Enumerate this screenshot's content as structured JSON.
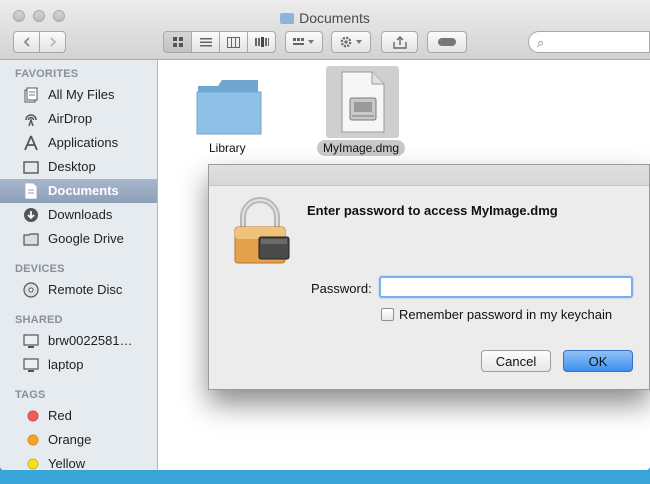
{
  "window": {
    "title": "Documents"
  },
  "toolbar": {
    "back_icon": "chevron-left-icon",
    "forward_icon": "chevron-right-icon",
    "view_icons": [
      "icon-view-icon",
      "list-view-icon",
      "column-view-icon",
      "cover-flow-icon"
    ],
    "arrange_icon": "arrange-grid-icon",
    "action_icon": "gear-icon",
    "share_icon": "share-icon",
    "tags_icon": "tag-pill-icon",
    "search": {
      "placeholder": "",
      "value": ""
    }
  },
  "sidebar": {
    "sections": {
      "favorites": "FAVORITES",
      "devices": "DEVICES",
      "shared": "SHARED",
      "tags": "TAGS"
    },
    "favorites": [
      {
        "label": "All My Files",
        "icon": "all-files-icon"
      },
      {
        "label": "AirDrop",
        "icon": "airdrop-icon"
      },
      {
        "label": "Applications",
        "icon": "applications-icon"
      },
      {
        "label": "Desktop",
        "icon": "desktop-icon"
      },
      {
        "label": "Documents",
        "icon": "documents-icon",
        "selected": true
      },
      {
        "label": "Downloads",
        "icon": "downloads-icon"
      },
      {
        "label": "Google Drive",
        "icon": "folder-icon"
      }
    ],
    "devices": [
      {
        "label": "Remote Disc",
        "icon": "disc-icon"
      }
    ],
    "shared": [
      {
        "label": "brw0022581…",
        "icon": "computer-icon"
      },
      {
        "label": "laptop",
        "icon": "computer-icon"
      }
    ],
    "tags": [
      {
        "label": "Red",
        "color": "#f25b5b"
      },
      {
        "label": "Orange",
        "color": "#f5a623"
      },
      {
        "label": "Yellow",
        "color": "#f3e01f"
      }
    ]
  },
  "files": [
    {
      "name": "Library",
      "icon": "folder-icon",
      "selected": false
    },
    {
      "name": "MyImage.dmg",
      "icon": "disk-image-icon",
      "selected": true
    }
  ],
  "dialog": {
    "message": "Enter password to access MyImage.dmg",
    "icon": "lock-icon",
    "password_label": "Password:",
    "password_value": "",
    "remember_label": "Remember password in my keychain",
    "remember_checked": false,
    "cancel_label": "Cancel",
    "ok_label": "OK"
  },
  "colors": {
    "accent": "#3f8ff0",
    "sidebar_bg": "#e6ebf0",
    "selection": "#8d9fb8"
  }
}
